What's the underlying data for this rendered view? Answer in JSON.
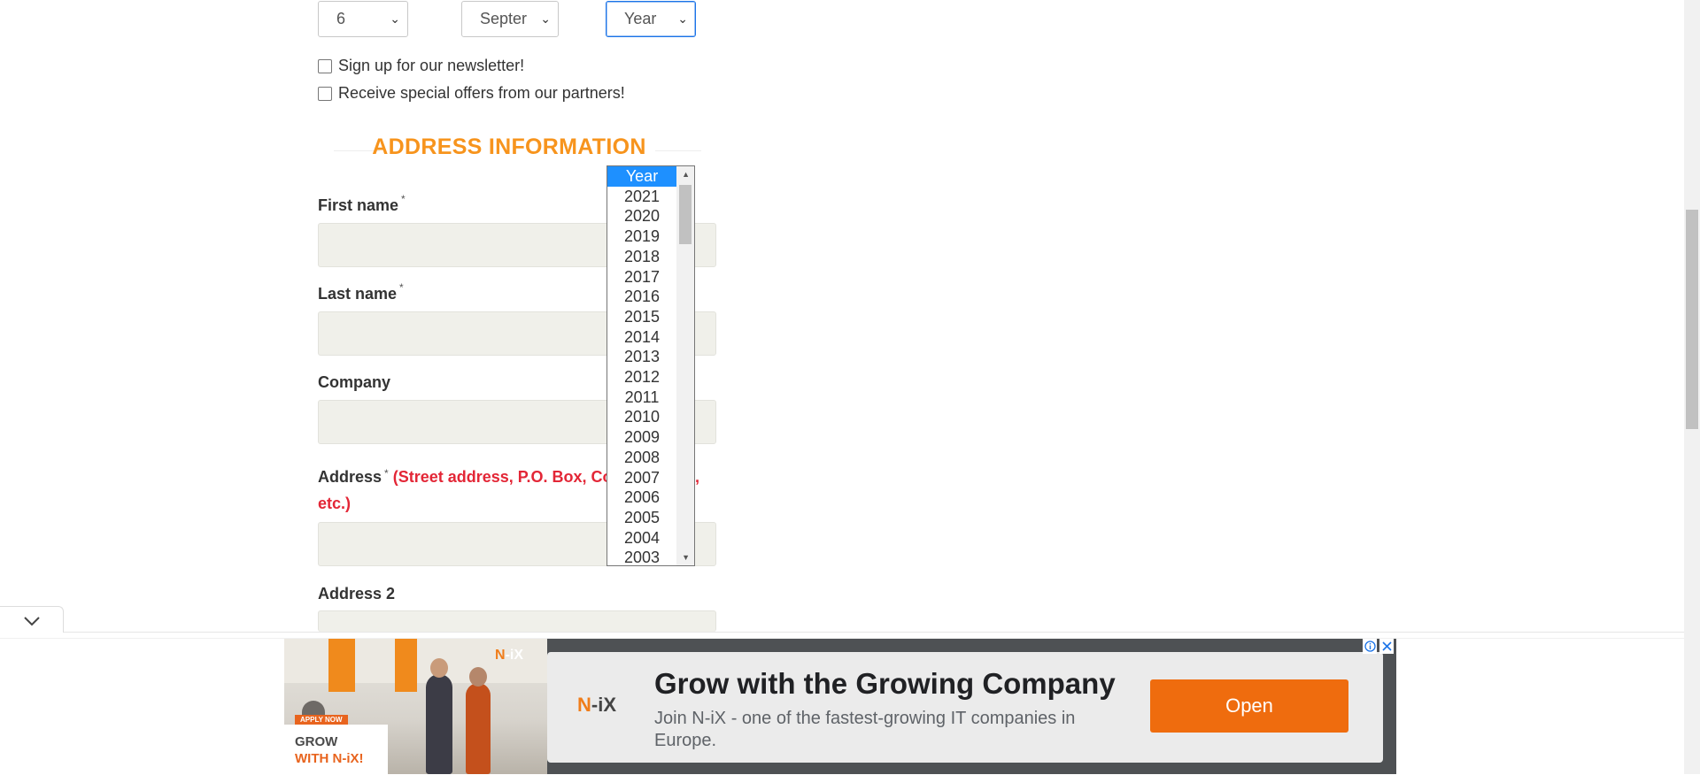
{
  "dob": {
    "day_value": "6",
    "month_value": "Septer",
    "year_value": "Year"
  },
  "checkboxes": {
    "newsletter": "Sign up for our newsletter!",
    "offers": "Receive special offers from our partners!"
  },
  "address_section": {
    "title": "ADDRESS INFORMATION",
    "first_name_label": "First name",
    "last_name_label": "Last name",
    "company_label": "Company",
    "address_label": "Address",
    "address_hint_line1": "(Street address, P.O. Box, Co",
    "address_hint_line1_end": "e,",
    "address_hint_line2": "etc.)",
    "address2_label": "Address 2",
    "required_mark": "*"
  },
  "year_dropdown": {
    "options": [
      "Year",
      "2021",
      "2020",
      "2019",
      "2018",
      "2017",
      "2016",
      "2015",
      "2014",
      "2013",
      "2012",
      "2011",
      "2010",
      "2009",
      "2008",
      "2007",
      "2006",
      "2005",
      "2004",
      "2003"
    ],
    "selected_index": 0
  },
  "ad": {
    "photo_brand": "N-iX",
    "apply_badge": "APPLY NOW",
    "grow_line1": "GROW",
    "grow_line2": "WITH N-iX!",
    "logo": "N-iX",
    "headline": "Grow with the Growing Company",
    "description": "Join N-iX - one of the fastest-growing IT companies in Europe.",
    "button_label": "Open",
    "info_icon": "info-icon",
    "close_icon": "close-icon"
  },
  "colors": {
    "section_title": "#f7941d",
    "hint_red": "#e32636",
    "selected_option": "#1e90ff",
    "ad_button": "#ef6c0e"
  }
}
